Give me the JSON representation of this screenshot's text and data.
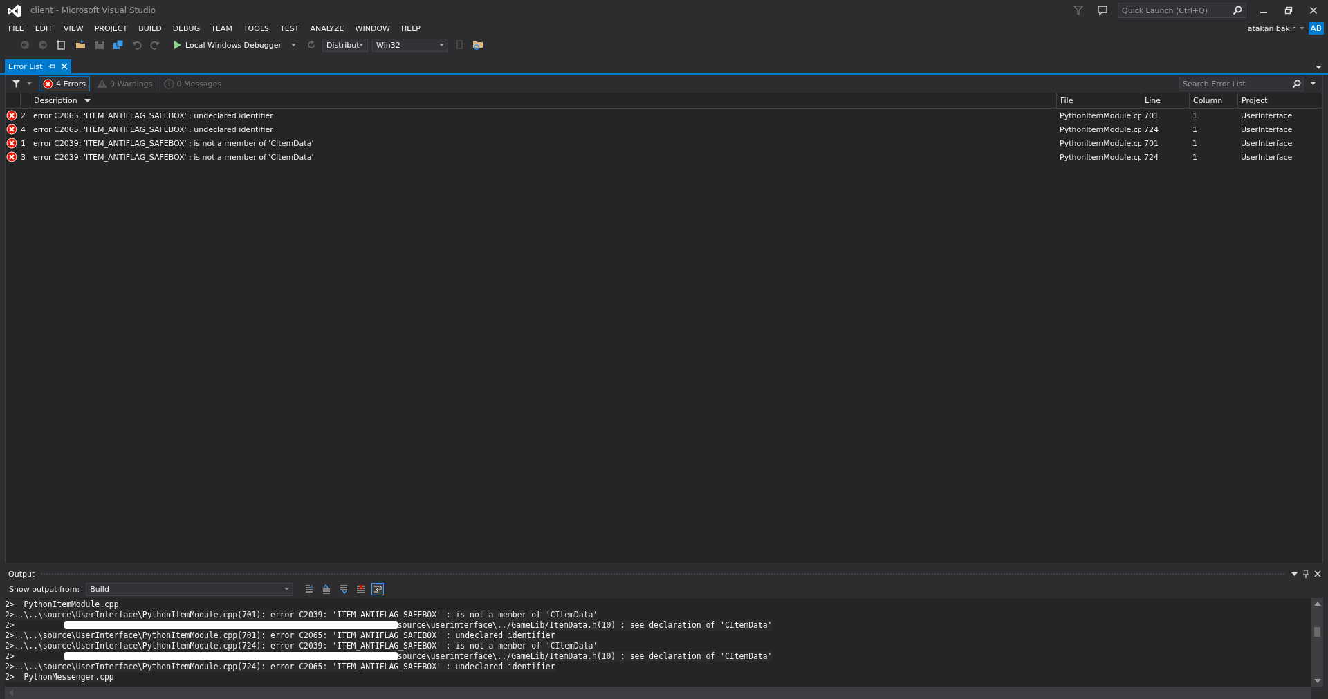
{
  "window": {
    "title": "client - Microsoft Visual Studio"
  },
  "quick_launch": {
    "placeholder": "Quick Launch (Ctrl+Q)"
  },
  "user": {
    "name": "atakan bakır",
    "initials": "AB"
  },
  "menu": [
    "FILE",
    "EDIT",
    "VIEW",
    "PROJECT",
    "BUILD",
    "DEBUG",
    "TEAM",
    "TOOLS",
    "TEST",
    "ANALYZE",
    "WINDOW",
    "HELP"
  ],
  "toolbar": {
    "debugger": "Local Windows Debugger",
    "configuration": "Distribut",
    "platform": "Win32"
  },
  "error_list": {
    "tab": "Error List",
    "filters": [
      {
        "label": "4 Errors",
        "kind": "error",
        "selected": true
      },
      {
        "label": "0 Warnings",
        "kind": "warning",
        "selected": false
      },
      {
        "label": "0 Messages",
        "kind": "message",
        "selected": false
      }
    ],
    "search": {
      "placeholder": "Search Error List"
    },
    "columns": [
      "Description",
      "File",
      "Line",
      "Column",
      "Project"
    ],
    "rows": [
      {
        "number": "2",
        "description": "error C2065: 'ITEM_ANTIFLAG_SAFEBOX' : undeclared identifier",
        "file": "PythonItemModule.cp",
        "line": "701",
        "column": "1",
        "project": "UserInterface"
      },
      {
        "number": "4",
        "description": "error C2065: 'ITEM_ANTIFLAG_SAFEBOX' : undeclared identifier",
        "file": "PythonItemModule.cp",
        "line": "724",
        "column": "1",
        "project": "UserInterface"
      },
      {
        "number": "1",
        "description": "error C2039: 'ITEM_ANTIFLAG_SAFEBOX' : is not a member of 'CItemData'",
        "file": "PythonItemModule.cp",
        "line": "701",
        "column": "1",
        "project": "UserInterface"
      },
      {
        "number": "3",
        "description": "error C2039: 'ITEM_ANTIFLAG_SAFEBOX' : is not a member of 'CItemData'",
        "file": "PythonItemModule.cp",
        "line": "724",
        "column": "1",
        "project": "UserInterface"
      }
    ]
  },
  "output": {
    "title": "Output",
    "source_label": "Show output from:",
    "source": "Build",
    "lines": [
      {
        "kind": "plain",
        "text": "2>  PythonItemModule.cpp"
      },
      {
        "kind": "plain",
        "text": "2>..\\..\\source\\UserInterface\\PythonItemModule.cpp(701): error C2039: 'ITEM_ANTIFLAG_SAFEBOX' : is not a member of 'CItemData'"
      },
      {
        "kind": "redacted",
        "prefix": "2>",
        "text": "source\\userinterface\\../GameLib/ItemData.h(10) : see declaration of 'CItemData'"
      },
      {
        "kind": "plain",
        "text": "2>..\\..\\source\\UserInterface\\PythonItemModule.cpp(701): error C2065: 'ITEM_ANTIFLAG_SAFEBOX' : undeclared identifier"
      },
      {
        "kind": "plain",
        "text": "2>..\\..\\source\\UserInterface\\PythonItemModule.cpp(724): error C2039: 'ITEM_ANTIFLAG_SAFEBOX' : is not a member of 'CItemData'"
      },
      {
        "kind": "redacted",
        "prefix": "2>",
        "text": "source\\userinterface\\../GameLib/ItemData.h(10) : see declaration of 'CItemData'"
      },
      {
        "kind": "plain",
        "text": "2>..\\..\\source\\UserInterface\\PythonItemModule.cpp(724): error C2065: 'ITEM_ANTIFLAG_SAFEBOX' : undeclared identifier"
      },
      {
        "kind": "plain",
        "text": "2>  PythonMessenger.cpp"
      }
    ]
  }
}
